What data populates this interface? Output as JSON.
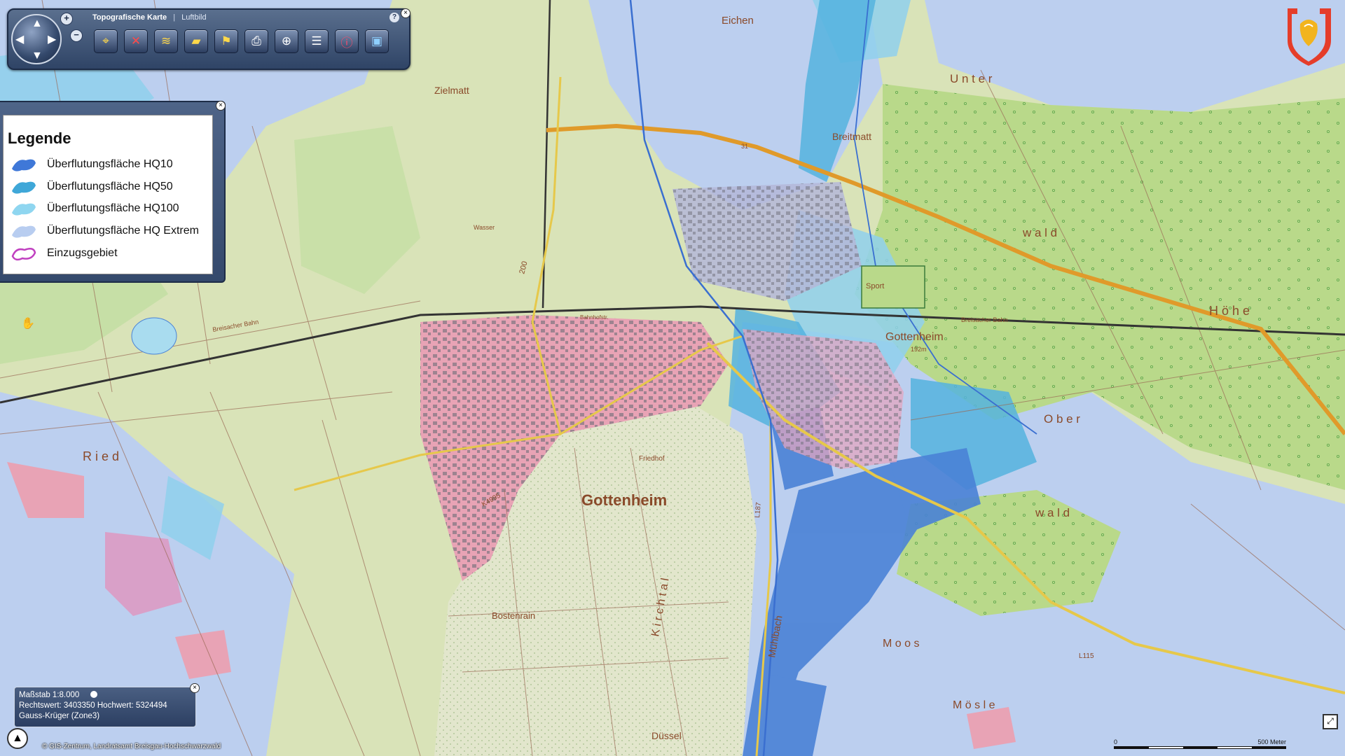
{
  "toolbar": {
    "tabs": [
      "Topografische Karte",
      "Luftbild"
    ],
    "zoom_in": "+",
    "zoom_out": "−",
    "help": "?",
    "close": "×",
    "tools": [
      {
        "name": "pan-tool",
        "icon": "binoculars-icon"
      },
      {
        "name": "measure-tool",
        "icon": "ruler-cross-icon"
      },
      {
        "name": "profile-tool",
        "icon": "profile-chart-icon"
      },
      {
        "name": "area-tool",
        "icon": "area-icon"
      },
      {
        "name": "marker-tool",
        "icon": "flag-icon"
      },
      {
        "name": "print-tool",
        "icon": "printer-icon"
      },
      {
        "name": "locate-tool",
        "icon": "crosshair-icon"
      },
      {
        "name": "report-tool",
        "icon": "document-icon"
      },
      {
        "name": "info-tool",
        "icon": "info-icon"
      },
      {
        "name": "export-tool",
        "icon": "save-icon"
      }
    ]
  },
  "legend": {
    "title": "Legende",
    "close": "×",
    "items": [
      {
        "label": "Überflutungsfläche HQ10",
        "color": "#3f78d8"
      },
      {
        "label": "Überflutungsfläche HQ50",
        "color": "#3fa7d8"
      },
      {
        "label": "Überflutungsfläche HQ100",
        "color": "#8fd6f0"
      },
      {
        "label": "Überflutungsfläche HQ Extrem",
        "color": "#b8cdf0"
      },
      {
        "label": "Einzugsgebiet",
        "color": "#c040c0"
      }
    ]
  },
  "scale_box": {
    "scale": "Maßstab 1:8.000",
    "coords": "Rechtswert: 3403350 Hochwert: 5324494",
    "crs": "Gauss-Krüger (Zone3)",
    "close": "×"
  },
  "copyright": "© GIS-Zentrum, Landratsamt Breisgau-Hochschwarzwald",
  "scalebar": {
    "start": "0",
    "end": "500 Meter"
  },
  "map_labels": {
    "eichen": "Eichen",
    "zielmatt": "Zielmatt",
    "breitmatt": "Breitmatt",
    "gottenheim_big": "Gottenheim",
    "gottenheim_small": "Gottenheim",
    "bostenrain": "Bostenrain",
    "kirchtal": "K i r c h t a l",
    "dussel": "Düssel",
    "ried": "R i e d",
    "sport": "Sport",
    "unter": "U n t e r",
    "wald1": "w a l d",
    "ober": "O b e r",
    "wald2": "w a l d",
    "hohe": "H ö h e",
    "mosle": "M ö s l e",
    "moos": "M o o s",
    "friedhof": "Friedhof",
    "muhlbach": "Mühlbach",
    "wasser": "Wasser",
    "road_b31": "31",
    "road_l115": "L115",
    "road_l187": "L187",
    "road_k4995": "K4995",
    "bahn1": "Breisacher Bahn",
    "bahn2": "Breisacher Bahn",
    "hoehe_val": "200",
    "gottenheim_elev": "192m",
    "bahnhof": "Bahnhofstr."
  },
  "colors": {
    "field": "#d9e3b8",
    "forest": "#b9d98a",
    "hq10": "#4a82d6",
    "hq50": "#55b3de",
    "hq100": "#a9dcef",
    "hq_extrem": "#bccfef",
    "settlement": "#e8a3b5",
    "vineyard": "#e2e6cc",
    "highway": "#e09a2a"
  }
}
